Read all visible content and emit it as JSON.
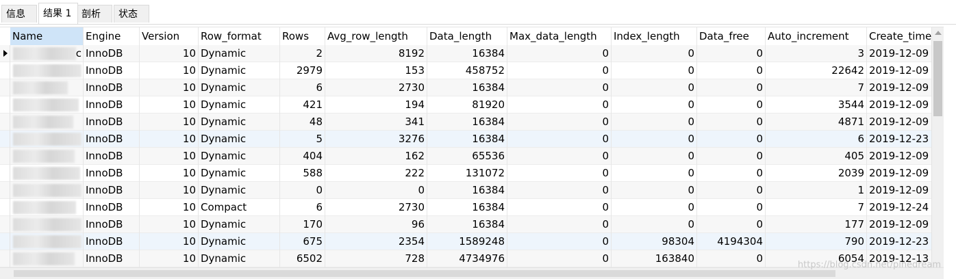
{
  "tabs": [
    {
      "label": "信息"
    },
    {
      "label": "结果 1"
    },
    {
      "label": "剖析"
    },
    {
      "label": "状态"
    }
  ],
  "columns": [
    "Name",
    "Engine",
    "Version",
    "Row_format",
    "Rows",
    "Avg_row_length",
    "Data_length",
    "Max_data_length",
    "Index_length",
    "Data_free",
    "Auto_increment",
    "Create_time"
  ],
  "rows": [
    {
      "name_tail": "c",
      "engine": "InnoDB",
      "version": "10",
      "row_format": "Dynamic",
      "rows": "2",
      "avg_row_length": "8192",
      "data_length": "16384",
      "max_data_length": "0",
      "index_length": "0",
      "data_free": "0",
      "auto_increment": "3",
      "create_time": "2019-12-09"
    },
    {
      "name_tail": "",
      "engine": "InnoDB",
      "version": "10",
      "row_format": "Dynamic",
      "rows": "2979",
      "avg_row_length": "153",
      "data_length": "458752",
      "max_data_length": "0",
      "index_length": "0",
      "data_free": "0",
      "auto_increment": "22642",
      "create_time": "2019-12-09"
    },
    {
      "name_tail": "",
      "engine": "InnoDB",
      "version": "10",
      "row_format": "Dynamic",
      "rows": "6",
      "avg_row_length": "2730",
      "data_length": "16384",
      "max_data_length": "0",
      "index_length": "0",
      "data_free": "0",
      "auto_increment": "7",
      "create_time": "2019-12-09"
    },
    {
      "name_tail": "",
      "engine": "InnoDB",
      "version": "10",
      "row_format": "Dynamic",
      "rows": "421",
      "avg_row_length": "194",
      "data_length": "81920",
      "max_data_length": "0",
      "index_length": "0",
      "data_free": "0",
      "auto_increment": "3544",
      "create_time": "2019-12-09"
    },
    {
      "name_tail": "",
      "engine": "InnoDB",
      "version": "10",
      "row_format": "Dynamic",
      "rows": "48",
      "avg_row_length": "341",
      "data_length": "16384",
      "max_data_length": "0",
      "index_length": "0",
      "data_free": "0",
      "auto_increment": "4871",
      "create_time": "2019-12-09"
    },
    {
      "name_tail": "",
      "engine": "InnoDB",
      "version": "10",
      "row_format": "Dynamic",
      "rows": "5",
      "avg_row_length": "3276",
      "data_length": "16384",
      "max_data_length": "0",
      "index_length": "0",
      "data_free": "0",
      "auto_increment": "6",
      "create_time": "2019-12-23"
    },
    {
      "name_tail": "",
      "engine": "InnoDB",
      "version": "10",
      "row_format": "Dynamic",
      "rows": "404",
      "avg_row_length": "162",
      "data_length": "65536",
      "max_data_length": "0",
      "index_length": "0",
      "data_free": "0",
      "auto_increment": "405",
      "create_time": "2019-12-09"
    },
    {
      "name_tail": "",
      "engine": "InnoDB",
      "version": "10",
      "row_format": "Dynamic",
      "rows": "588",
      "avg_row_length": "222",
      "data_length": "131072",
      "max_data_length": "0",
      "index_length": "0",
      "data_free": "0",
      "auto_increment": "2039",
      "create_time": "2019-12-09"
    },
    {
      "name_tail": "",
      "engine": "InnoDB",
      "version": "10",
      "row_format": "Dynamic",
      "rows": "0",
      "avg_row_length": "0",
      "data_length": "16384",
      "max_data_length": "0",
      "index_length": "0",
      "data_free": "0",
      "auto_increment": "1",
      "create_time": "2019-12-09"
    },
    {
      "name_tail": "",
      "engine": "InnoDB",
      "version": "10",
      "row_format": "Compact",
      "rows": "6",
      "avg_row_length": "2730",
      "data_length": "16384",
      "max_data_length": "0",
      "index_length": "0",
      "data_free": "0",
      "auto_increment": "7",
      "create_time": "2019-12-24"
    },
    {
      "name_tail": "",
      "engine": "InnoDB",
      "version": "10",
      "row_format": "Dynamic",
      "rows": "170",
      "avg_row_length": "96",
      "data_length": "16384",
      "max_data_length": "0",
      "index_length": "0",
      "data_free": "0",
      "auto_increment": "177",
      "create_time": "2019-12-09"
    },
    {
      "name_tail": "",
      "engine": "InnoDB",
      "version": "10",
      "row_format": "Dynamic",
      "rows": "675",
      "avg_row_length": "2354",
      "data_length": "1589248",
      "max_data_length": "0",
      "index_length": "98304",
      "data_free": "4194304",
      "auto_increment": "790",
      "create_time": "2019-12-23"
    },
    {
      "name_tail": "",
      "engine": "InnoDB",
      "version": "10",
      "row_format": "Dynamic",
      "rows": "6502",
      "avg_row_length": "728",
      "data_length": "4734976",
      "max_data_length": "0",
      "index_length": "163840",
      "data_free": "0",
      "auto_increment": "6054",
      "create_time": "2019-12-13"
    }
  ],
  "watermark": "https://blog.csdn.net/pinedream"
}
